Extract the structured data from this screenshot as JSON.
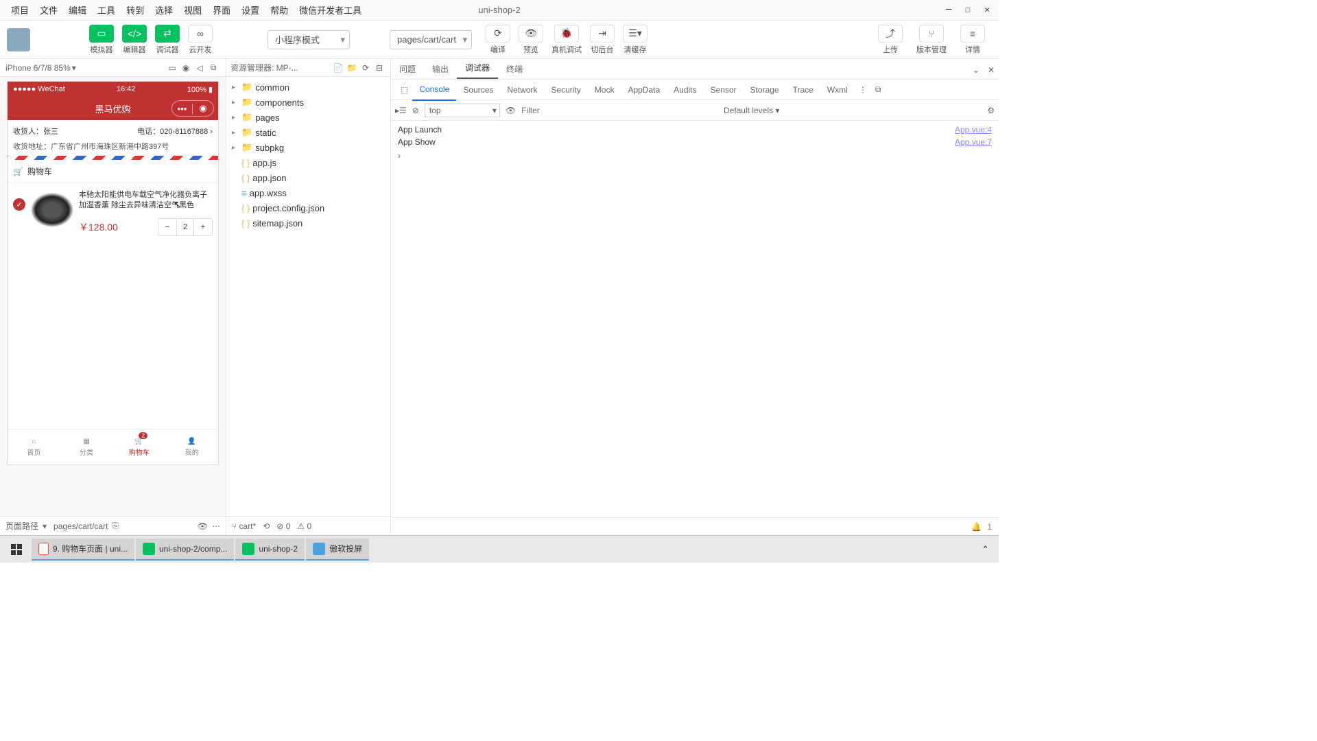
{
  "menu": {
    "items": [
      "项目",
      "文件",
      "编辑",
      "工具",
      "转到",
      "选择",
      "视图",
      "界面",
      "设置",
      "帮助",
      "微信开发者工具"
    ],
    "title": "uni-shop-2"
  },
  "toolbar": {
    "buttons": [
      {
        "label": "模拟器",
        "id": "simulator"
      },
      {
        "label": "编辑器",
        "id": "editor"
      },
      {
        "label": "调试器",
        "id": "debugger"
      }
    ],
    "cloud": "云开发",
    "mode": "小程序模式",
    "page": "pages/cart/cart",
    "actions": [
      {
        "label": "编译",
        "id": "compile"
      },
      {
        "label": "预览",
        "id": "preview"
      },
      {
        "label": "真机调试",
        "id": "remote-debug"
      },
      {
        "label": "切后台",
        "id": "background"
      },
      {
        "label": "清缓存",
        "id": "clear-cache"
      }
    ],
    "right": [
      {
        "label": "上传",
        "id": "upload"
      },
      {
        "label": "版本管理",
        "id": "version"
      },
      {
        "label": "详情",
        "id": "details"
      }
    ]
  },
  "simulator": {
    "device": "iPhone 6/7/8 85%",
    "statusbar": {
      "carrier": "●●●●● WeChat",
      "time": "16:42",
      "battery": "100%"
    },
    "nav_title": "黑马优购",
    "address": {
      "recipient_label": "收货人：",
      "recipient": "张三",
      "phone_label": "电话：",
      "phone": "020-81167888",
      "addr_label": "收货地址：",
      "addr": "广东省广州市海珠区新港中路397号"
    },
    "cart_header": "购物车",
    "item": {
      "name": "本驰太阳能供电车载空气净化器负离子加湿香薰 除尘去异味清洁空气黑色",
      "price": "￥128.00",
      "qty": "2"
    },
    "tabs": [
      {
        "label": "首页",
        "id": "home"
      },
      {
        "label": "分类",
        "id": "category"
      },
      {
        "label": "购物车",
        "id": "cart",
        "badge": "2",
        "active": true
      },
      {
        "label": "我的",
        "id": "mine"
      }
    ],
    "path_label": "页面路径",
    "path": "pages/cart/cart"
  },
  "explorer": {
    "title": "资源管理器: MP-...",
    "folders": [
      "common",
      "components",
      "pages",
      "static",
      "subpkg"
    ],
    "files": [
      {
        "name": "app.js",
        "type": "js"
      },
      {
        "name": "app.json",
        "type": "json"
      },
      {
        "name": "app.wxss",
        "type": "css"
      },
      {
        "name": "project.config.json",
        "type": "json"
      },
      {
        "name": "sitemap.json",
        "type": "json"
      }
    ],
    "bottom": {
      "branch": "cart*",
      "err": "0",
      "warn": "0"
    }
  },
  "devtools": {
    "tabs": [
      "问题",
      "输出",
      "调试器",
      "终端"
    ],
    "active_tab": "调试器",
    "subtabs": [
      "Console",
      "Sources",
      "Network",
      "Security",
      "Mock",
      "AppData",
      "Audits",
      "Sensor",
      "Storage",
      "Trace",
      "Wxml"
    ],
    "active_sub": "Console",
    "context": "top",
    "filter_placeholder": "Filter",
    "levels": "Default levels",
    "logs": [
      {
        "msg": "App Launch",
        "src": "App.vue:4"
      },
      {
        "msg": "App Show",
        "src": "App.vue:7"
      }
    ],
    "status_count": "1"
  },
  "taskbar": {
    "items": [
      {
        "label": "9. 购物车页面 | uni...",
        "color": "#ea4335",
        "active": true
      },
      {
        "label": "uni-shop-2/comp...",
        "color": "#07c160",
        "active": true
      },
      {
        "label": "uni-shop-2",
        "color": "#07c160",
        "active": true
      },
      {
        "label": "傲软投屏",
        "color": "#4aa3df",
        "active": true
      }
    ]
  }
}
